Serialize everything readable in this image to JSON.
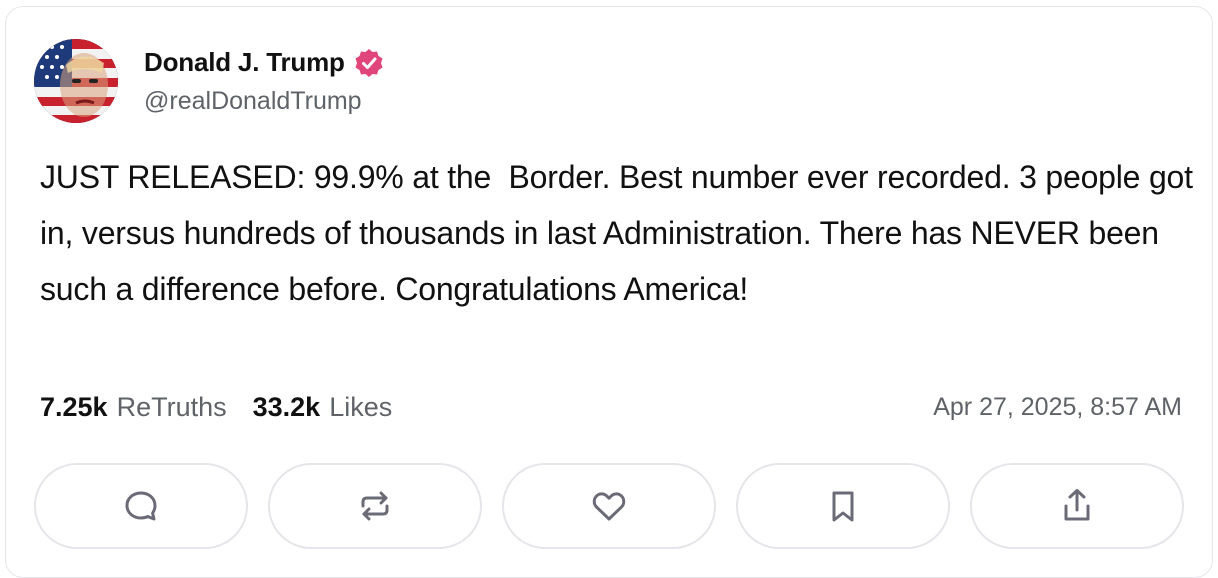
{
  "author": {
    "display_name": "Donald J. Trump",
    "handle": "@realDonaldTrump",
    "verified_icon": "verified-badge-icon",
    "verified_color": "#e0457b"
  },
  "post": {
    "text": "JUST RELEASED: 99.9% at the  Border. Best number ever recorded. 3 people got in, versus hundreds of thousands in last Administration. There has NEVER been such a difference before. Congratulations America!"
  },
  "stats": {
    "retruths_count": "7.25k",
    "retruths_label": "ReTruths",
    "likes_count": "33.2k",
    "likes_label": "Likes",
    "timestamp": "Apr 27, 2025, 8:57 AM"
  },
  "actions": [
    {
      "icon": "reply-icon"
    },
    {
      "icon": "retruth-icon"
    },
    {
      "icon": "heart-icon"
    },
    {
      "icon": "bookmark-icon"
    },
    {
      "icon": "share-icon"
    }
  ],
  "colors": {
    "text": "#111111",
    "muted": "#5f6368",
    "border": "#e5e5ea",
    "icon": "#6b6b78"
  }
}
